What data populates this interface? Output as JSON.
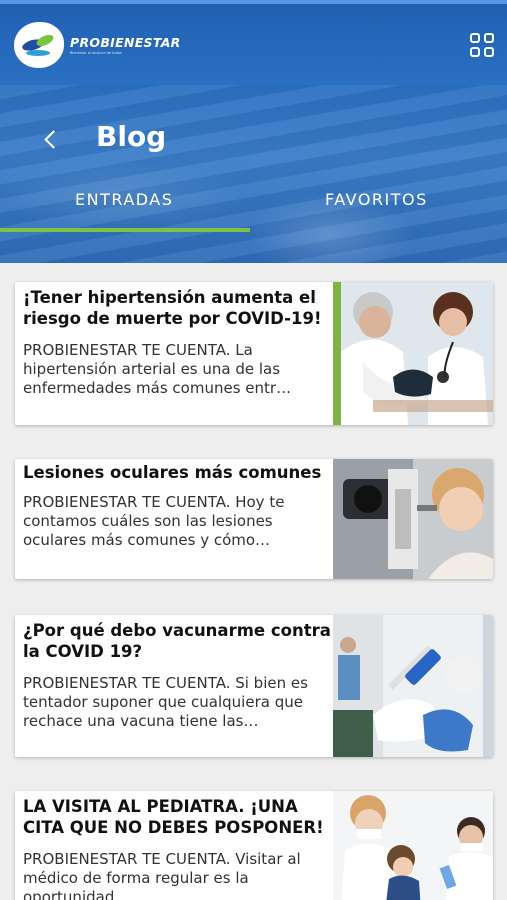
{
  "header": {
    "brand": "PROBIENESTAR",
    "tagline": "Bienestar al alcance de todos",
    "title": "Blog",
    "colors": {
      "primary": "#2a6fc0",
      "accent": "#7cc243"
    }
  },
  "tabs": [
    {
      "label": "ENTRADAS",
      "active": true
    },
    {
      "label": "FAVORITOS",
      "active": false
    }
  ],
  "posts": [
    {
      "title": "¡Tener hipertensión aumenta el riesgo de muerte por COVID-19!",
      "excerpt": "PROBIENESTAR TE CUENTA. La hipertensión arterial es una de las enfermedades más comunes entr…",
      "image": "doctor-blood-pressure-photo"
    },
    {
      "title": "Lesiones oculares más comunes",
      "excerpt": "PROBIENESTAR TE CUENTA. Hoy te contamos cuáles son las lesiones oculares más comunes y cómo…",
      "image": "eye-exam-photo"
    },
    {
      "title": "¿Por qué debo vacunarme contra la COVID 19?",
      "excerpt": "PROBIENESTAR TE CUENTA. Si bien es tentador suponer que cualquiera que rechace una vacuna tiene las…",
      "image": "vaccine-syringe-photo"
    },
    {
      "title": "LA VISITA AL PEDIATRA. ¡UNA CITA QUE NO DEBES POSPONER!",
      "excerpt": "PROBIENESTAR TE CUENTA. Visitar al médico de forma regular es la oportunidad…",
      "image": "pediatrician-visit-photo"
    }
  ]
}
